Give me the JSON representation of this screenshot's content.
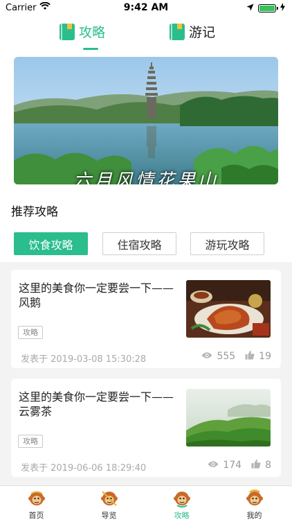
{
  "status_bar": {
    "carrier": "Carrier",
    "time": "9:42 AM",
    "battery_level": 1.0,
    "battery_color": "#35c45a"
  },
  "top_tabs": [
    {
      "label": "攻略",
      "icon": "book-icon",
      "active": true
    },
    {
      "label": "游记",
      "icon": "book-icon",
      "active": false
    }
  ],
  "banner": {
    "title": "六月风情花果山"
  },
  "section": {
    "title": "推荐攻略"
  },
  "chips": [
    {
      "label": "饮食攻略",
      "active": true
    },
    {
      "label": "住宿攻略",
      "active": false
    },
    {
      "label": "游玩攻略",
      "active": false
    }
  ],
  "articles": [
    {
      "title": "这里的美食你一定要尝一下——风鹅",
      "tag": "攻略",
      "date": "发表于 2019-03-08 15:30:28",
      "views": "555",
      "likes": "19",
      "thumb": "food-photo"
    },
    {
      "title": "这里的美食你一定要尝一下——云雾茶",
      "tag": "攻略",
      "date": "发表于 2019-06-06 18:29:40",
      "views": "174",
      "likes": "8",
      "thumb": "tea-field-photo"
    }
  ],
  "tabbar": [
    {
      "label": "首页",
      "icon": "monkey-icon",
      "active": false
    },
    {
      "label": "导览",
      "icon": "monkey-icon",
      "active": false
    },
    {
      "label": "攻略",
      "icon": "monkey-icon",
      "active": true
    },
    {
      "label": "我的",
      "icon": "monkey-icon",
      "active": false
    }
  ],
  "colors": {
    "accent": "#2bbd8d",
    "tab_icon_accent": "#f3c23b",
    "background_list": "#f3f3f3"
  }
}
